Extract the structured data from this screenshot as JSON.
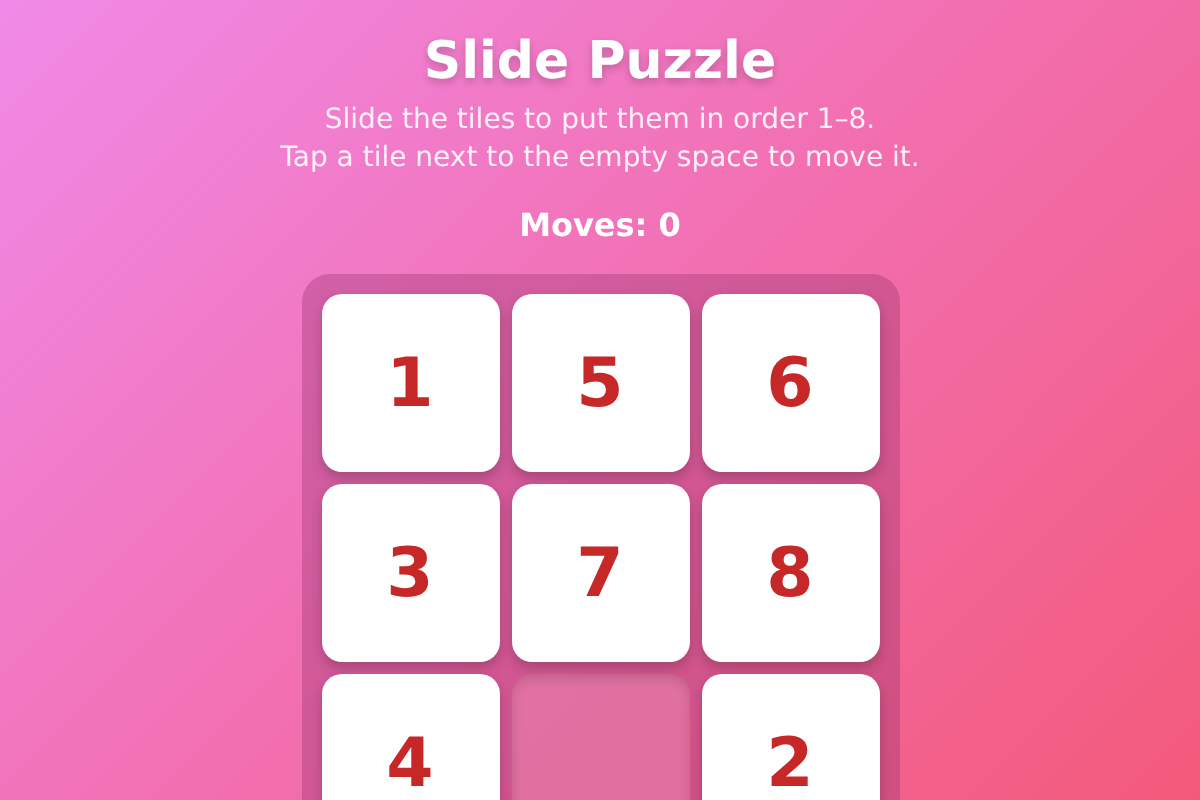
{
  "title": "Slide Puzzle",
  "instructions": [
    "Slide the tiles to put them in order 1–8.",
    "Tap a tile next to the empty space to move it."
  ],
  "moves": "Moves: 0",
  "tiles": [
    {
      "kind": "number",
      "label": "1"
    },
    {
      "kind": "number",
      "label": "5"
    },
    {
      "kind": "number",
      "label": "6"
    },
    {
      "kind": "number",
      "label": "3"
    },
    {
      "kind": "number",
      "label": "7"
    },
    {
      "kind": "number",
      "label": "8"
    },
    {
      "kind": "number",
      "label": "4"
    },
    {
      "kind": "empty"
    },
    {
      "kind": "number",
      "label": "2"
    }
  ]
}
